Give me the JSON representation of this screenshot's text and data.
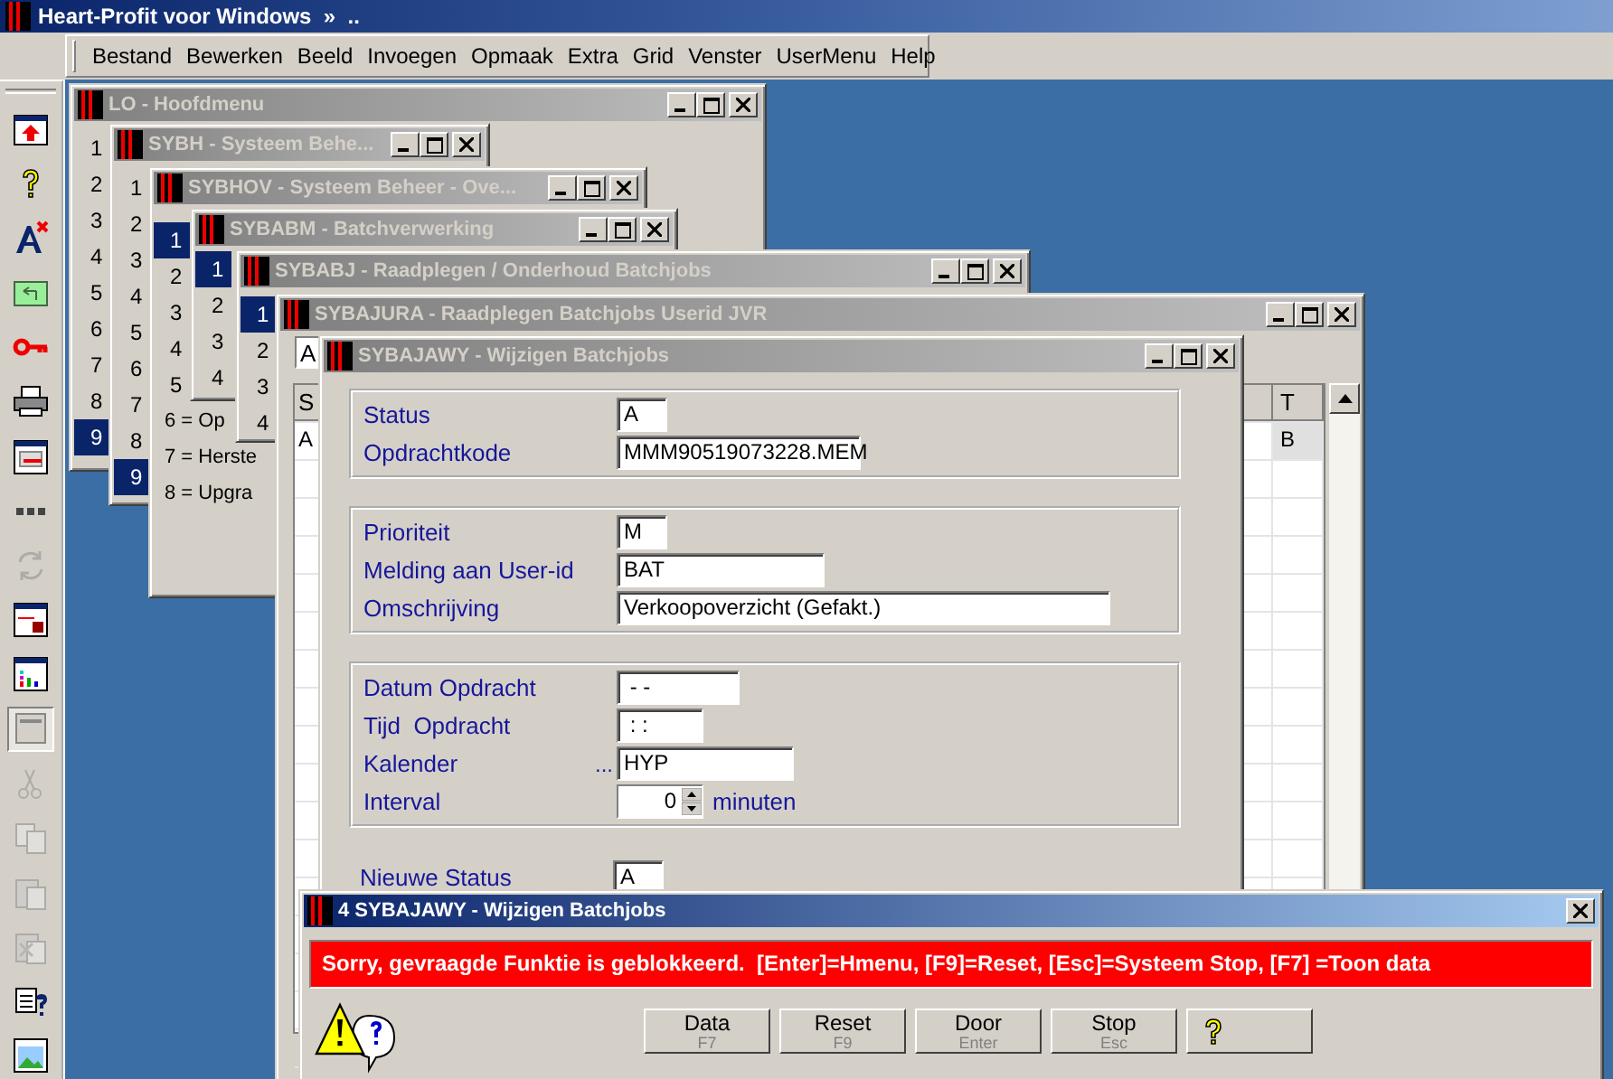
{
  "app": {
    "title": "Heart-Profit voor Windows  »  .."
  },
  "menu": [
    "Bestand",
    "Bewerken",
    "Beeld",
    "Invoegen",
    "Opmaak",
    "Extra",
    "Grid",
    "Venster",
    "UserMenu",
    "Help"
  ],
  "toolbar": [
    {
      "disabled": false,
      "pressed": false
    },
    {
      "disabled": false,
      "pressed": false
    },
    {
      "disabled": false,
      "pressed": false
    },
    {
      "disabled": false,
      "pressed": false
    },
    {
      "disabled": false,
      "pressed": false
    },
    {
      "disabled": false,
      "pressed": false
    },
    {
      "disabled": false,
      "pressed": false
    },
    {
      "disabled": false,
      "pressed": false
    },
    {
      "disabled": true,
      "pressed": false
    },
    {
      "disabled": false,
      "pressed": false
    },
    {
      "disabled": false,
      "pressed": false
    },
    {
      "disabled": false,
      "pressed": true
    },
    {
      "disabled": true,
      "pressed": false
    },
    {
      "disabled": true,
      "pressed": false
    },
    {
      "disabled": true,
      "pressed": false
    },
    {
      "disabled": true,
      "pressed": false
    },
    {
      "disabled": false,
      "pressed": false
    },
    {
      "disabled": false,
      "pressed": false
    }
  ],
  "windows": [
    {
      "kind": "menu",
      "title": "LO - Hoofdmenu",
      "active": false,
      "items": [
        {
          "label": "1",
          "selected": false
        },
        {
          "label": "2",
          "selected": false
        },
        {
          "label": "3",
          "selected": false
        },
        {
          "label": "4",
          "selected": false
        },
        {
          "label": "5",
          "selected": false
        },
        {
          "label": "6",
          "selected": false
        },
        {
          "label": "7",
          "selected": false
        },
        {
          "label": "8",
          "selected": false
        },
        {
          "label": "9",
          "selected": true
        }
      ]
    },
    {
      "kind": "menu",
      "title": "SYBH - Systeem Behe...",
      "active": false,
      "items": [
        {
          "label": "1",
          "selected": false
        },
        {
          "label": "2",
          "selected": false
        },
        {
          "label": "3",
          "selected": false
        },
        {
          "label": "4",
          "selected": false
        },
        {
          "label": "5",
          "selected": false
        },
        {
          "label": "6",
          "selected": false
        },
        {
          "label": "7",
          "selected": false
        },
        {
          "label": "8",
          "selected": false
        },
        {
          "label": "9",
          "selected": true
        }
      ]
    },
    {
      "kind": "menu",
      "title": "SYBHOV - Systeem Beheer - Ove...",
      "active": false,
      "items": [
        {
          "label": "1",
          "selected": true
        },
        {
          "label": "2",
          "selected": false
        },
        {
          "label": "3",
          "selected": false
        },
        {
          "label": "4",
          "selected": false
        },
        {
          "label": "5",
          "selected": false
        },
        {
          "label": "6 = Op",
          "selected": false
        },
        {
          "label": "7 = Herste",
          "selected": false
        },
        {
          "label": "8 = Upgra",
          "selected": false
        }
      ]
    },
    {
      "kind": "menu",
      "title": "SYBABM - Batchverwerking",
      "active": false,
      "items": [
        {
          "label": "1",
          "selected": true
        },
        {
          "label": "2",
          "selected": false
        },
        {
          "label": "3",
          "selected": false
        },
        {
          "label": "4",
          "selected": false
        }
      ]
    },
    {
      "kind": "menu",
      "title": "SYBABJ - Raadplegen / Onderhoud Batchjobs",
      "active": false,
      "items": [
        {
          "label": "1",
          "selected": true
        },
        {
          "label": "2",
          "selected": false
        },
        {
          "label": "3",
          "selected": false
        },
        {
          "label": "4",
          "selected": false
        }
      ]
    },
    {
      "kind": "grid",
      "title": "SYBAJURA - Raadplegen Batchjobs Userid JVR",
      "active": false,
      "filter_value": "A",
      "columns": [
        "S",
        "T"
      ],
      "rows": [
        [
          "A",
          "B"
        ]
      ]
    },
    {
      "kind": "form",
      "title": "SYBAJAWY - Wijzigen Batchjobs",
      "active": false,
      "groups": [
        {
          "framed": true,
          "fields": [
            {
              "label": "Status",
              "value": "A"
            },
            {
              "label": "Opdrachtkode",
              "value": "MMM90519073228.MEM"
            }
          ]
        },
        {
          "framed": true,
          "fields": [
            {
              "label": "Prioriteit",
              "value": "M"
            },
            {
              "label": "Melding aan User-id",
              "value": "BAT"
            },
            {
              "label": "Omschrijving",
              "value": "Verkoopoverzicht (Gefakt.)"
            }
          ]
        },
        {
          "framed": true,
          "fields": [
            {
              "label": "Datum Opdracht",
              "value": " - -"
            },
            {
              "label": "Tijd  Opdracht",
              "value": " : :"
            },
            {
              "label": "Kalender",
              "prefix": "...",
              "value": "HYP"
            },
            {
              "label": "Interval",
              "kind": "spin",
              "value": "0",
              "suffix": "minuten"
            }
          ]
        },
        {
          "framed": false,
          "fields": [
            {
              "label": "Nieuwe Status",
              "value": "A"
            }
          ]
        }
      ]
    }
  ],
  "dialog": {
    "title": "4 SYBAJAWY - Wijzigen Batchjobs",
    "active": true,
    "message": "Sorry, gevraagde Funktie is geblokkeerd.  [Enter]=Hmenu, [F9]=Reset, [Esc]=Systeem Stop, [F7] =Toon data",
    "buttons": [
      {
        "kind": "text",
        "label": "Data",
        "key": "F7"
      },
      {
        "kind": "text",
        "label": "Reset",
        "key": "F9"
      },
      {
        "kind": "text",
        "label": "Door",
        "key": "Enter"
      },
      {
        "kind": "text",
        "label": "Stop",
        "key": "Esc"
      },
      {
        "kind": "help"
      }
    ]
  }
}
